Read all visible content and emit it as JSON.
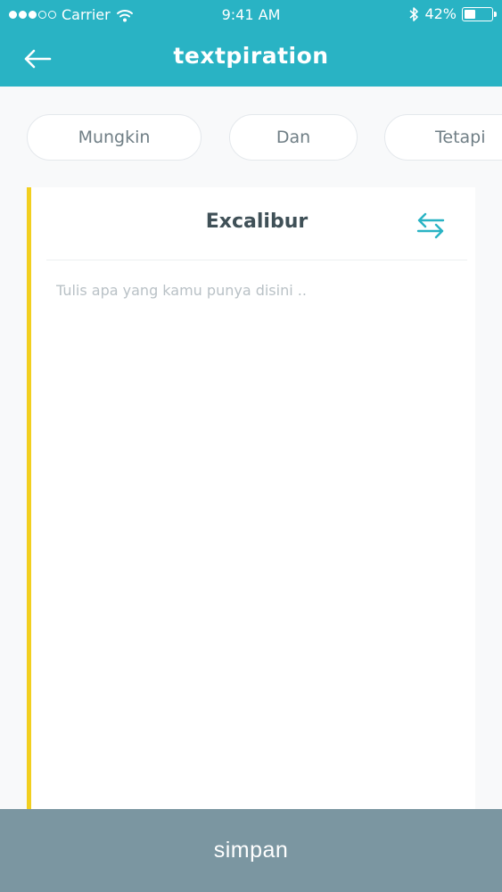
{
  "status_bar": {
    "carrier": "Carrier",
    "time": "9:41 AM",
    "battery_text": "42%",
    "battery_level": 0.42
  },
  "nav": {
    "title": "textpiration",
    "back_icon": "arrow-left-icon"
  },
  "chips": [
    {
      "label": "Mungkin"
    },
    {
      "label": "Dan"
    },
    {
      "label": "Tetapi"
    }
  ],
  "card": {
    "title": "Excalibur",
    "swap_icon": "swap-arrows-icon",
    "input_value": "",
    "input_placeholder": "Tulis apa yang kamu punya disini .."
  },
  "save_button": {
    "label": "simpan"
  },
  "colors": {
    "primary": "#29b3c4",
    "accent_bar": "#f2cf1f",
    "save_bar": "#7b96a1",
    "title_text": "#3f5057",
    "chip_text": "#6f7e85"
  }
}
